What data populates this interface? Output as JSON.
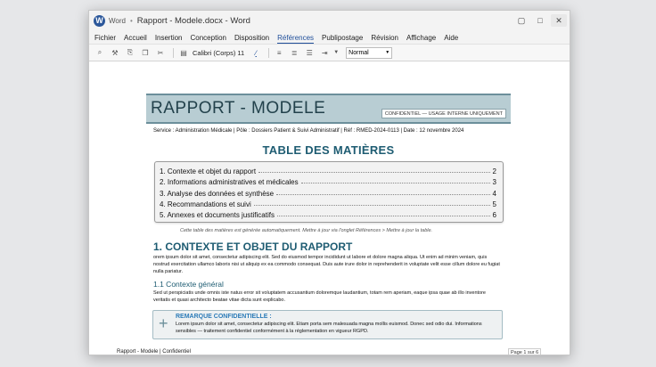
{
  "window": {
    "app_name": "Word",
    "separator": "•",
    "doc_title": "Rapport - Modele.docx - Word",
    "controls": {
      "minimize": "▢",
      "restore": "□",
      "close": "✕"
    }
  },
  "menu": [
    "Fichier",
    "Accueil",
    "Insertion",
    "Conception",
    "Disposition",
    "Références",
    "Publipostage",
    "Révision",
    "Affichage",
    "Aide"
  ],
  "menu_active": "Références",
  "toolbar": {
    "font": "Calibri (Corps) 11",
    "style": "Normal",
    "style_arrow": "▼",
    "dropdown_arrow": "▼",
    "icons": [
      "paint-icon",
      "brush-icon",
      "paste-icon",
      "copy-icon",
      "cut-icon",
      "save-icon",
      "text-color-icon",
      "align-icon",
      "align-icon",
      "list-icon",
      "indent-icon"
    ]
  },
  "doc": {
    "banner_title": "RAPPORT - MODELE",
    "confidential_tag": "CONFIDENTIEL — USAGE INTERNE UNIQUEMENT",
    "meta": "Service : Administration Médicale | Pôle : Dossiers Patient & Suivi Administratif | Réf : RMED-2024-0113 | Date : 12 novembre 2024",
    "toc_title": "TABLE DES MATIÈRES",
    "toc": [
      {
        "label": "1. Contexte et objet du rapport",
        "page": "2"
      },
      {
        "label": "2. Informations administratives et médicales",
        "page": "3"
      },
      {
        "label": "3. Analyse des données et synthèse",
        "page": "4"
      },
      {
        "label": "4. Recommandations et suivi",
        "page": "5"
      },
      {
        "label": "5. Annexes et documents justificatifs",
        "page": "6"
      }
    ],
    "toc_note": "Cette table des matières est générée automatiquement. Mettre à jour via l'onglet Références > Mettre à jour la table.",
    "h1": "1. CONTEXTE ET OBJET DU RAPPORT",
    "p1": "orem ipsum dolor sit amet, consectetur adipiscing elit. Sed do eiusmod tempor incididunt ut labore et dolore magna aliqua. Ut enim ad minim veniam, quis nostrud exercitation ullamco laboris nisi ut aliquip ex ea commodo consequat. Duis aute irure dolor in reprehenderit in voluptate velit esse cillum dolore eu fugiat nulla pariatur.",
    "h2": "1.1 Contexte général",
    "p2": "Sed ut perspiciatis unde omnis iste natus error sit voluptatem accusantium doloremque laudantium, totam rem aperiam, eaque ipsa quae ab illo inventore veritatis et quasi architecto beatae vitae dicta sunt explicabo.",
    "note_icon": "+",
    "note_title": "REMARQUE CONFIDENTIELLE :",
    "note_body": "Lorem ipsum dolor sit amet, consectetur adipiscing elit. Etiam porta sem malesuada magna mollis euismod. Donec sed odio dui. Informations sensibles — traitement confidentiel conformément à la réglementation en vigueur RGPD."
  },
  "footer": {
    "left": "Rapport - Modele | Confidentiel",
    "right": "Page 1 sur 6"
  },
  "colors": {
    "accent": "#1e5c72",
    "banner": "#b8cdd3",
    "word_blue": "#2b579a"
  }
}
